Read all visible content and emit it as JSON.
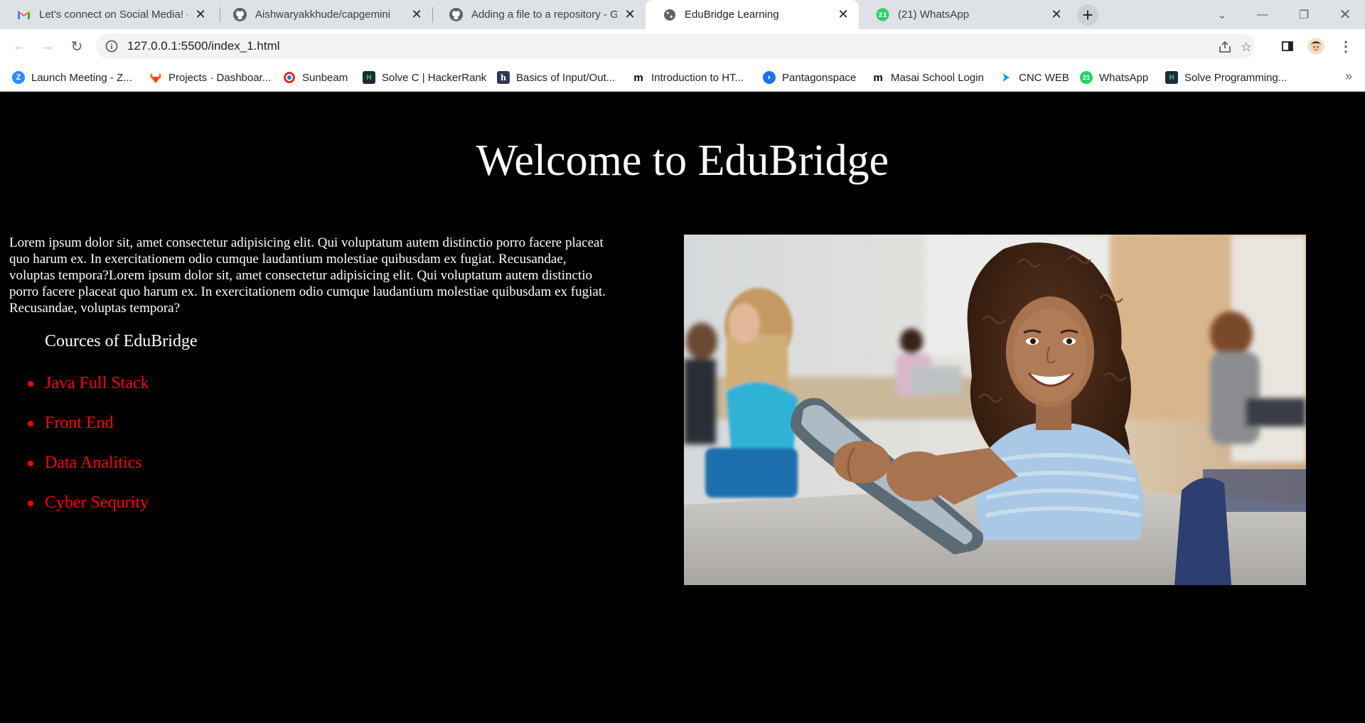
{
  "browser": {
    "tabs": [
      {
        "title": "Let's connect on Social Media! - a",
        "icon": "gmail-icon"
      },
      {
        "title": "Aishwaryakkhude/capgemini",
        "icon": "github-icon"
      },
      {
        "title": "Adding a file to a repository - Git",
        "icon": "github-icon"
      },
      {
        "title": "EduBridge Learning",
        "icon": "globe-icon",
        "active": true
      },
      {
        "title": "(21) WhatsApp",
        "icon": "whatsapp-icon"
      }
    ],
    "url": "127.0.0.1:5500/index_1.html",
    "bookmarks": [
      {
        "label": "Launch Meeting - Z...",
        "icon": "zoom-icon",
        "color": "#2d8cff"
      },
      {
        "label": "Projects · Dashboar...",
        "icon": "gitlab-icon",
        "color": "#fc6d26"
      },
      {
        "label": "Sunbeam",
        "icon": "sunbeam-icon",
        "color": "#d93025"
      },
      {
        "label": "Solve C | HackerRank",
        "icon": "hackerrank-icon",
        "color": "#1e2b3a"
      },
      {
        "label": "Basics of Input/Out...",
        "icon": "hackerearth-icon",
        "color": "#323754"
      },
      {
        "label": "Introduction to HT...",
        "icon": "masai-icon",
        "color": "#000000"
      },
      {
        "label": "Pantagonspace",
        "icon": "pantagon-icon",
        "color": "#1a73e8"
      },
      {
        "label": "Masai School Login",
        "icon": "masai-icon",
        "color": "#000000"
      },
      {
        "label": "CNC WEB",
        "icon": "cnc-icon",
        "color": "#1a9ae0"
      },
      {
        "label": "WhatsApp",
        "icon": "whatsapp-icon",
        "color": "#25d366"
      },
      {
        "label": "Solve Programming...",
        "icon": "hackerrank-icon",
        "color": "#1e2b3a"
      }
    ],
    "bookmarks_more": "»"
  },
  "page": {
    "heading": "Welcome to EduBridge",
    "paragraph": "Lorem ipsum dolor sit, amet consectetur adipisicing elit. Qui voluptatum autem distinctio porro facere placeat quo harum ex. In exercitationem odio cumque laudantium molestiae quibusdam ex fugiat. Recusandae, voluptas tempora?Lorem ipsum dolor sit, amet consectetur adipisicing elit. Qui voluptatum autem distinctio porro facere placeat quo harum ex. In exercitationem odio cumque laudantium molestiae quibusdam ex fugiat. Recusandae, voluptas tempora?",
    "courses_title": "Cources of EduBridge",
    "courses": [
      "Java Full Stack",
      "Front End",
      "Data Analitics",
      "Cyber Sequrity"
    ],
    "course_color": "#ff0000",
    "background": "#000000"
  }
}
